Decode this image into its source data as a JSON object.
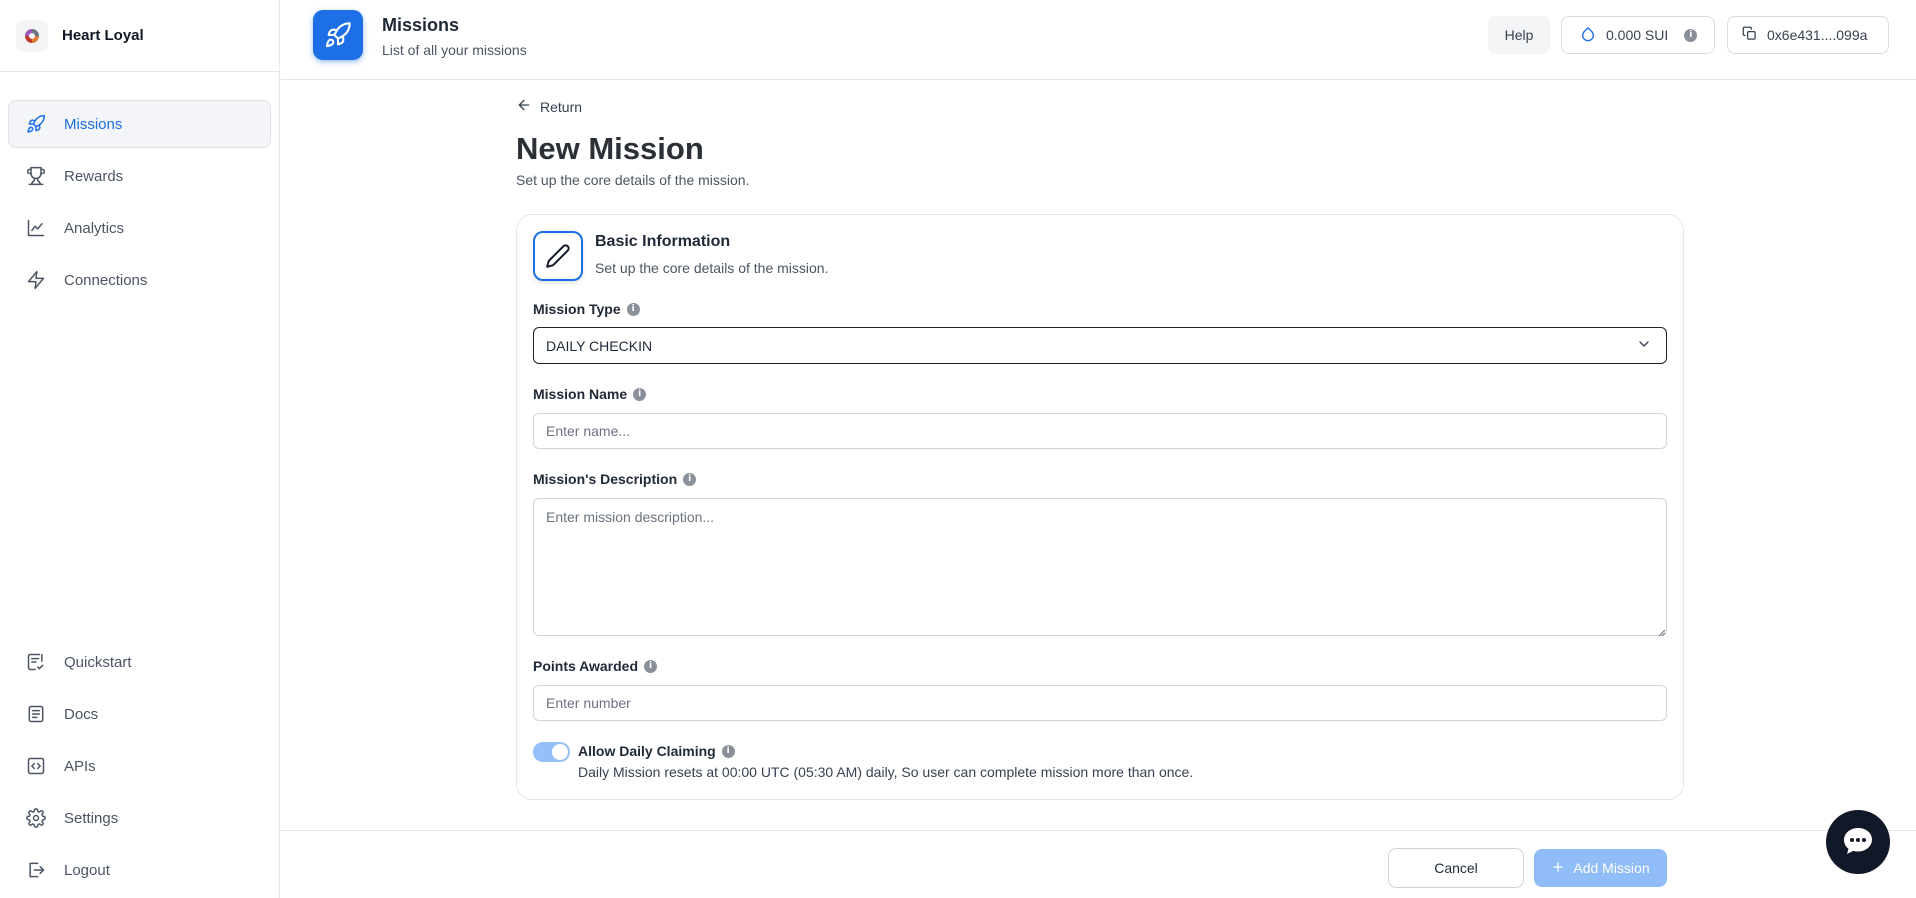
{
  "brand": {
    "name": "Heart Loyal"
  },
  "sidebar": {
    "items": [
      {
        "label": "Missions",
        "icon": "rocket-icon",
        "active": true
      },
      {
        "label": "Rewards",
        "icon": "trophy-icon"
      },
      {
        "label": "Analytics",
        "icon": "chart-line-icon"
      },
      {
        "label": "Connections",
        "icon": "lightning-icon"
      }
    ],
    "bottom_items": [
      {
        "label": "Quickstart",
        "icon": "checklist-icon"
      },
      {
        "label": "Docs",
        "icon": "document-icon"
      },
      {
        "label": "APIs",
        "icon": "code-icon"
      },
      {
        "label": "Settings",
        "icon": "gear-icon"
      },
      {
        "label": "Logout",
        "icon": "logout-icon"
      }
    ]
  },
  "header": {
    "title": "Missions",
    "subtitle": "List of all your missions",
    "help_label": "Help",
    "balance": "0.000 SUI",
    "wallet_address": "0x6e431....099a"
  },
  "page": {
    "return_label": "Return",
    "title": "New Mission",
    "subtitle": "Set up the core details of the mission."
  },
  "card": {
    "title": "Basic Information",
    "subtitle": "Set up the core details of the mission.",
    "mission_type": {
      "label": "Mission Type",
      "value": "DAILY CHECKIN"
    },
    "mission_name": {
      "label": "Mission Name",
      "placeholder": "Enter name..."
    },
    "description": {
      "label": "Mission's Description",
      "placeholder": "Enter mission description..."
    },
    "points": {
      "label": "Points Awarded",
      "placeholder": "Enter number"
    },
    "daily_claiming": {
      "label": "Allow Daily Claiming",
      "enabled": true,
      "description": "Daily Mission resets at 00:00 UTC (05:30 AM) daily, So user can complete mission more than once."
    }
  },
  "footer": {
    "cancel_label": "Cancel",
    "add_label": "Add Mission"
  },
  "colors": {
    "accent": "#1d6fe5",
    "accent_disabled": "#90bdf7",
    "toggle_on": "#93c0f7"
  }
}
